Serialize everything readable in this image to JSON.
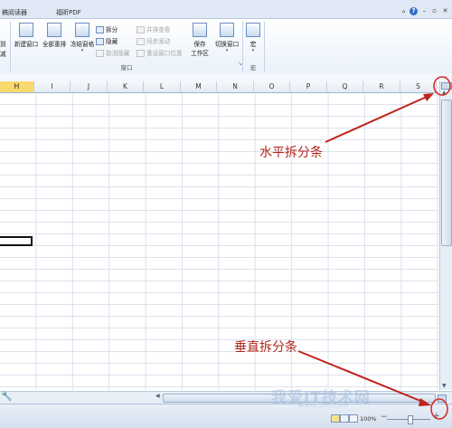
{
  "tabs": [
    "稿阅读器",
    "福昕PDF"
  ],
  "ribbon": {
    "left_fragments": [
      "到",
      "减"
    ],
    "new_window": "新建窗口",
    "arrange_all": "全部重排",
    "freeze_panes": "冻结窗格",
    "split": "拆分",
    "hide": "隐藏",
    "unhide": "取消隐藏",
    "view_side_by_side": "并排查看",
    "sync_scroll": "同步滚动",
    "reset_position": "重设窗口位置",
    "save_workspace_line1": "保存",
    "save_workspace_line2": "工作区",
    "switch_windows": "切换窗口",
    "macros": "宏",
    "group_window": "窗口",
    "group_macros": "宏"
  },
  "columns": [
    "H",
    "I",
    "J",
    "K",
    "L",
    "M",
    "N",
    "O",
    "P",
    "Q",
    "R",
    "S"
  ],
  "selected_column": "H",
  "status": {
    "zoom": "100%"
  },
  "annotations": {
    "horizontal_split": "水平拆分条",
    "vertical_split": "垂直拆分条"
  },
  "watermark": {
    "main": "我爱IT技术网",
    "sub": "www.52ij.com"
  },
  "colors": {
    "annotation": "#b3261e",
    "selected_header": "#f8d96f",
    "ribbon_bg": "#eaf1fa"
  }
}
